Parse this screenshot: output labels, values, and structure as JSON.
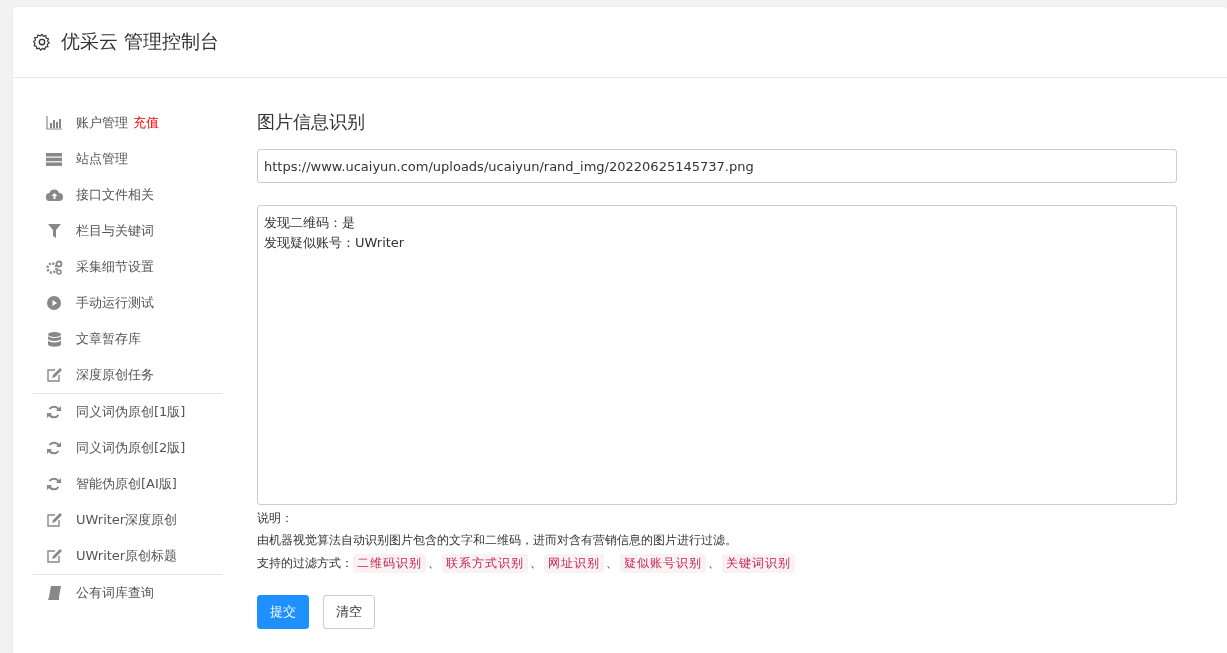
{
  "header": {
    "title": "优采云 管理控制台"
  },
  "sidebar": {
    "sections": [
      {
        "items": [
          {
            "label": "账户管理",
            "badge": "充值"
          },
          {
            "label": "站点管理"
          },
          {
            "label": "接口文件相关"
          },
          {
            "label": "栏目与关键词"
          },
          {
            "label": "采集细节设置"
          },
          {
            "label": "手动运行测试"
          },
          {
            "label": "文章暂存库"
          },
          {
            "label": "深度原创任务"
          }
        ]
      },
      {
        "items": [
          {
            "label": "同义词伪原创[1版]"
          },
          {
            "label": "同义词伪原创[2版]"
          },
          {
            "label": "智能伪原创[AI版]"
          },
          {
            "label": "UWriter深度原创"
          },
          {
            "label": "UWriter原创标题"
          }
        ]
      },
      {
        "items": [
          {
            "label": "公有词库查询"
          }
        ]
      }
    ]
  },
  "main": {
    "title": "图片信息识别",
    "url_field": {
      "value": "https://www.ucaiyun.com/uploads/ucaiyun/rand_img/20220625145737.png"
    },
    "result_area": {
      "lines": [
        "发现二维码：是",
        "发现疑似账号：UWriter"
      ]
    },
    "notes": {
      "heading": "说明：",
      "description": "由机器视觉算法自动识别图片包含的文字和二维码，进而对含有营销信息的图片进行过滤。",
      "methods_label": "支持的过滤方式：",
      "methods": [
        "二维码识别",
        "联系方式识别",
        "网址识别",
        "疑似账号识别",
        "关键词识别"
      ],
      "separator": "、"
    },
    "buttons": [
      {
        "label": "提交",
        "kind": "primary"
      },
      {
        "label": "清空",
        "kind": "default"
      }
    ]
  }
}
